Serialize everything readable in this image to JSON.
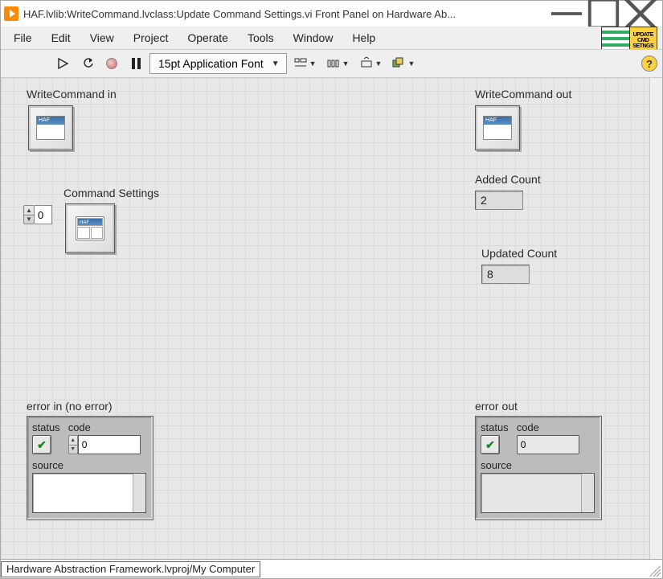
{
  "window": {
    "title": "HAF.lvlib:WriteCommand.lvclass:Update Command Settings.vi Front Panel on Hardware Ab..."
  },
  "menu": {
    "file": "File",
    "edit": "Edit",
    "view": "View",
    "project": "Project",
    "operate": "Operate",
    "tools": "Tools",
    "window": "Window",
    "help": "Help"
  },
  "toolbar": {
    "font": "15pt Application Font",
    "vi_icon_text": "UPDATE\nCMD\nSETNGS"
  },
  "controls": {
    "write_in": {
      "label": "WriteCommand in"
    },
    "write_out": {
      "label": "WriteCommand out"
    },
    "command_settings": {
      "label": "Command Settings",
      "index": "0"
    },
    "added_count": {
      "label": "Added Count",
      "value": "2"
    },
    "updated_count": {
      "label": "Updated Count",
      "value": "8"
    },
    "error_in": {
      "label": "error in (no error)",
      "status_label": "status",
      "code_label": "code",
      "code_value": "0",
      "source_label": "source",
      "source_value": ""
    },
    "error_out": {
      "label": "error out",
      "status_label": "status",
      "code_label": "code",
      "code_value": "0",
      "source_label": "source",
      "source_value": ""
    }
  },
  "statusbar": {
    "text": "Hardware Abstraction Framework.lvproj/My Computer"
  }
}
